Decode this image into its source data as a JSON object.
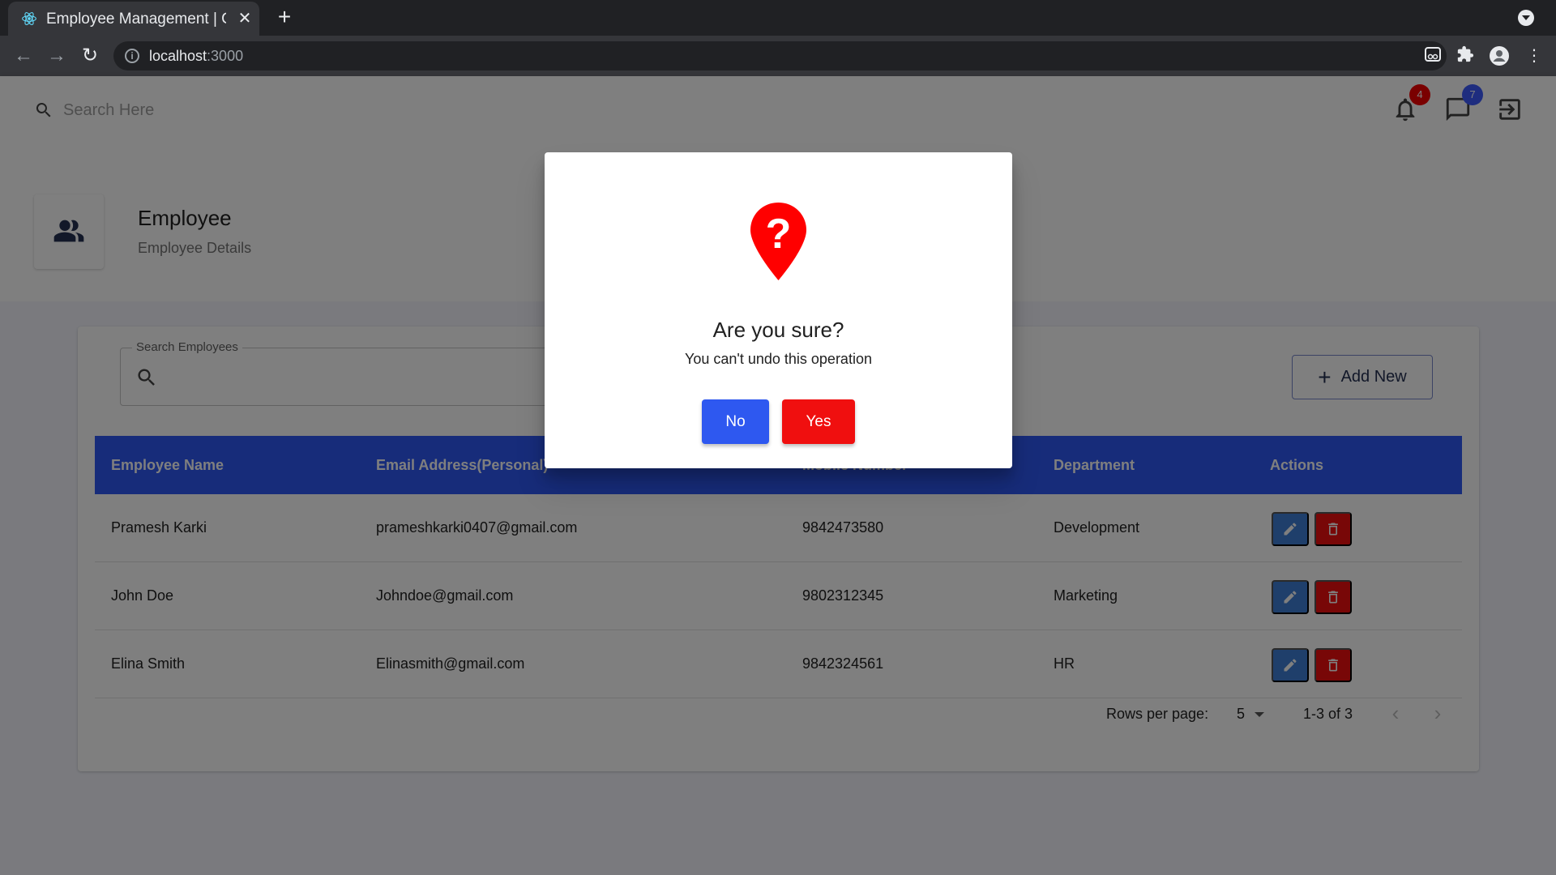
{
  "browser": {
    "tab_title": "Employee Management | C",
    "url_host": "localhost",
    "url_port": ":3000"
  },
  "header": {
    "search_placeholder": "Search Here",
    "notifications_count": "4",
    "messages_count": "7",
    "colors": {
      "notification_badge": "#f50000",
      "message_badge": "#3d5afe"
    }
  },
  "page_header": {
    "title": "Employee",
    "subtitle": "Employee Details",
    "icon": "people-icon"
  },
  "employees": {
    "search_label": "Search Employees",
    "search_value": "",
    "add_new_label": "Add New",
    "columns": [
      "Employee Name",
      "Email Address(Personal)",
      "Mobile Number",
      "Department",
      "Actions"
    ],
    "rows": [
      {
        "name": "Pramesh Karki",
        "email": "prameshkarki0407@gmail.com",
        "mobile": "9842473580",
        "department": "Development"
      },
      {
        "name": "John Doe",
        "email": "Johndoe@gmail.com",
        "mobile": "9802312345",
        "department": "Marketing"
      },
      {
        "name": "Elina Smith",
        "email": "Elinasmith@gmail.com",
        "mobile": "9842324561",
        "department": "HR"
      }
    ],
    "pagination": {
      "rows_per_page_label": "Rows per page:",
      "rows_per_page": "5",
      "range": "1-3 of 3"
    }
  },
  "dialog": {
    "title": "Are you sure?",
    "subtitle": "You can't undo this operation",
    "no_label": "No",
    "yes_label": "Yes",
    "icon": "question-pin-icon"
  },
  "colors": {
    "primary": "#2f58f5",
    "danger": "#f00f0f",
    "edit": "#3f7fd6"
  }
}
